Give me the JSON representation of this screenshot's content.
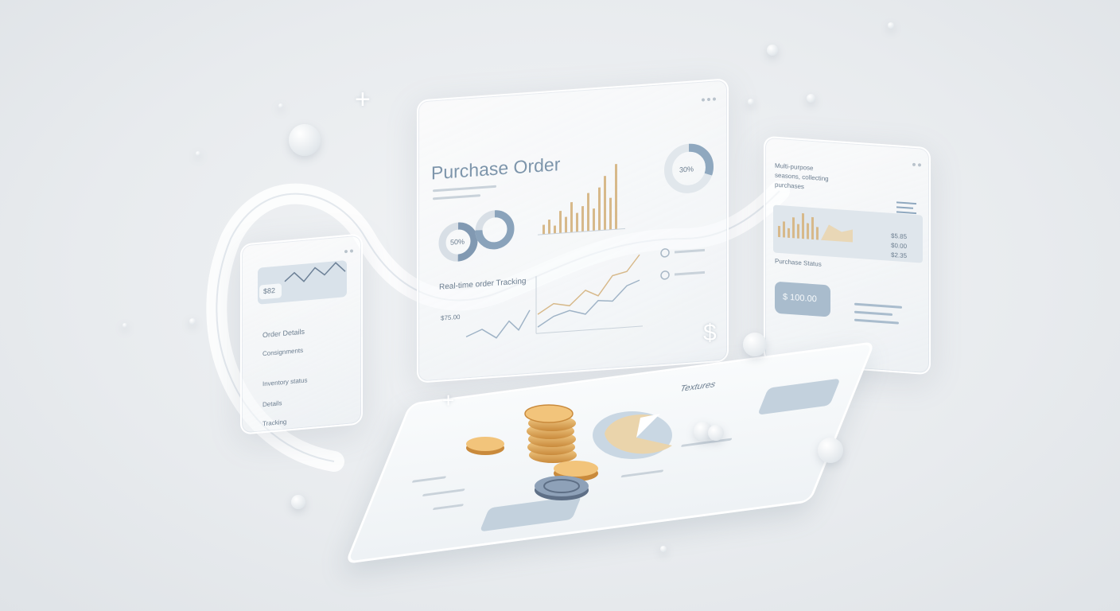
{
  "main_panel": {
    "title": "Purchase Order",
    "donut_left_label": "50%",
    "donut_right_label": "",
    "top_donut_label": "30%",
    "section_label": "Real-time order Tracking",
    "side_value": "$75.00"
  },
  "left_panel": {
    "badge": "$82",
    "rows": [
      "Order Details",
      "Consignments",
      "Inventory status",
      "Details",
      "Tracking"
    ]
  },
  "right_panel": {
    "heading_lines": [
      "Multi-purpose",
      "seasons, collecting",
      "purchases"
    ],
    "mid_label": "Purchase Status",
    "stats": [
      "$5.85",
      "$0.00",
      "$2.35"
    ],
    "price_button": "$ 100.00"
  },
  "tablet": {
    "title": "Textures",
    "currency_symbol": "$"
  },
  "colors": {
    "accent_blue": "#7f9ab5",
    "gold": "#d9b27a",
    "line_blue": "#9fb3c6"
  }
}
